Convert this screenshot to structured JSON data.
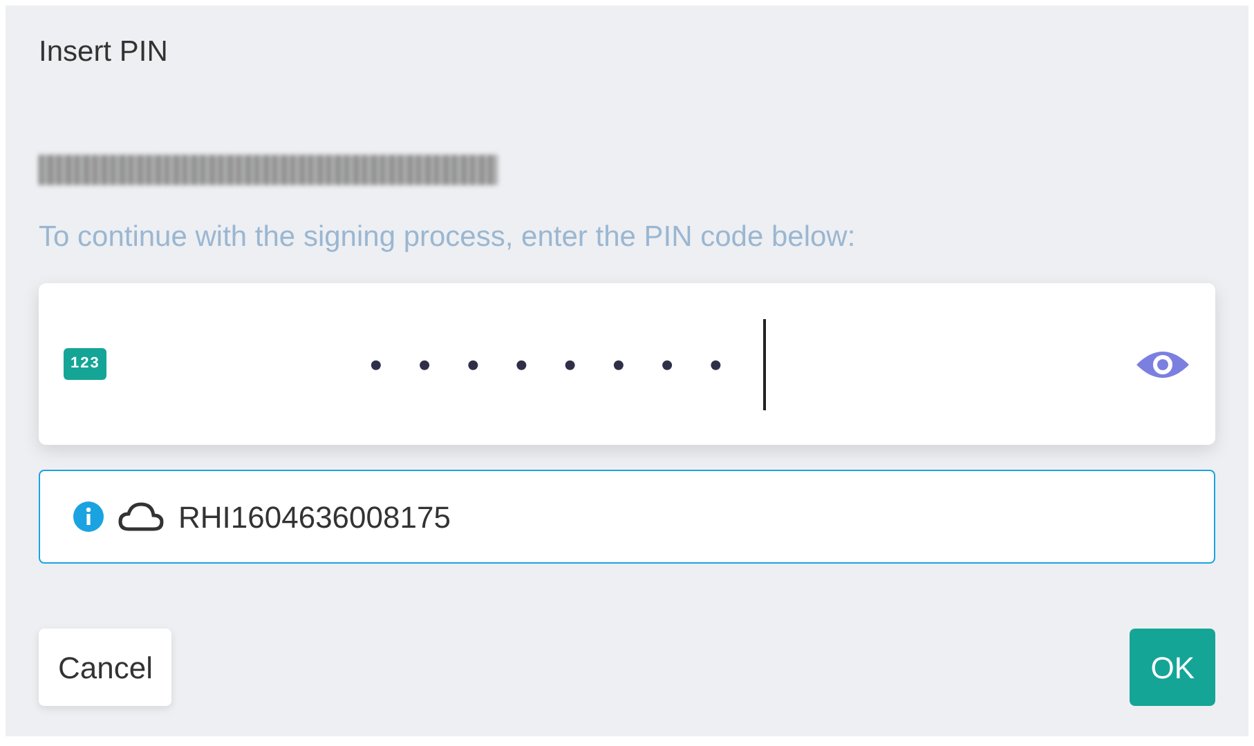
{
  "dialog": {
    "title": "Insert PIN"
  },
  "signer_name": {
    "redacted": true
  },
  "instruction": "To continue with the signing process, enter the PIN code below:",
  "pin_field": {
    "badge": "123",
    "value": "••••••••",
    "focused": true
  },
  "info": {
    "text": "RHI1604636008175"
  },
  "buttons": [
    {
      "label": "Cancel",
      "kind": "secondary"
    },
    {
      "label": "OK",
      "kind": "primary"
    }
  ]
}
